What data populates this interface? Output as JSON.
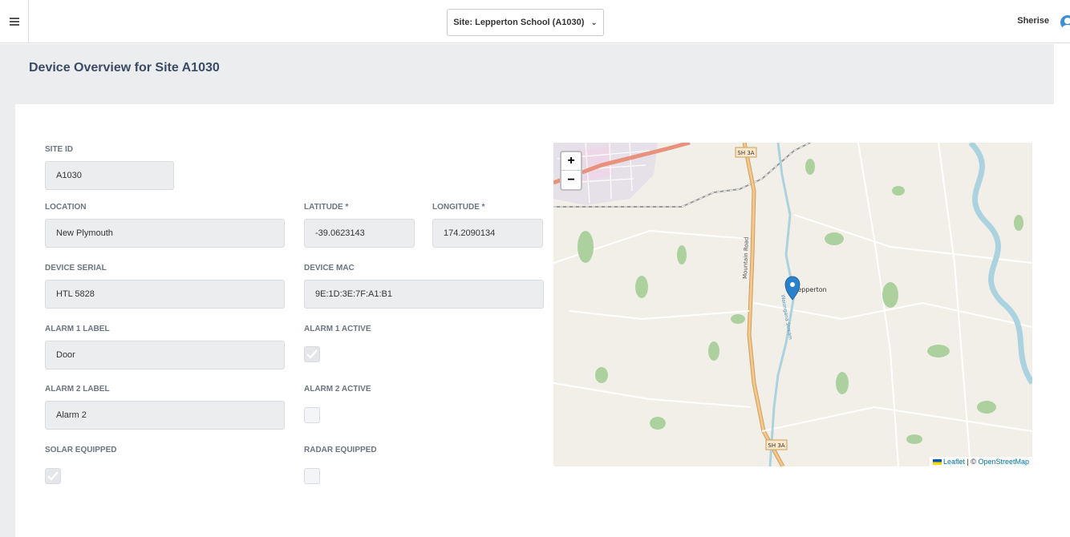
{
  "topbar": {
    "site_selector": "Site: Lepperton School (A1030)",
    "user_name": "Sherise"
  },
  "page": {
    "title": "Device Overview for Site A1030"
  },
  "form": {
    "site_id": {
      "label": "SITE ID",
      "value": "A1030"
    },
    "location": {
      "label": "LOCATION",
      "value": "New Plymouth"
    },
    "latitude": {
      "label": "LATITUDE *",
      "value": "-39.0623143"
    },
    "longitude": {
      "label": "LONGITUDE *",
      "value": "174.2090134"
    },
    "device_serial": {
      "label": "DEVICE SERIAL",
      "value": "HTL 5828"
    },
    "device_mac": {
      "label": "DEVICE MAC",
      "value": "9E:1D:3E:7F:A1:B1"
    },
    "alarm1_label": {
      "label": "ALARM 1 LABEL",
      "value": "Door"
    },
    "alarm1_active": {
      "label": "ALARM 1 ACTIVE",
      "checked": true
    },
    "alarm2_label": {
      "label": "ALARM 2 LABEL",
      "value": "Alarm 2"
    },
    "alarm2_active": {
      "label": "ALARM 2 ACTIVE",
      "checked": false
    },
    "solar_equipped": {
      "label": "SOLAR EQUIPPED",
      "checked": true
    },
    "radar_equipped": {
      "label": "RADAR EQUIPPED",
      "checked": false
    }
  },
  "map": {
    "zoom_in": "+",
    "zoom_out": "−",
    "road_label_1": "SH 3A",
    "road_label_2": "SH 3A",
    "road_name": "Mountain Road",
    "stream_name": "Waiongana Stream",
    "place_label": "Lepperton",
    "attribution_leaflet": "Leaflet",
    "attribution_sep": " | © ",
    "attribution_osm": "OpenStreetMap",
    "colors": {
      "land": "#f2efe9",
      "wood": "#add19e",
      "water": "#aad3df",
      "road": "#f7c68b",
      "marker": "#2a81cb"
    }
  }
}
